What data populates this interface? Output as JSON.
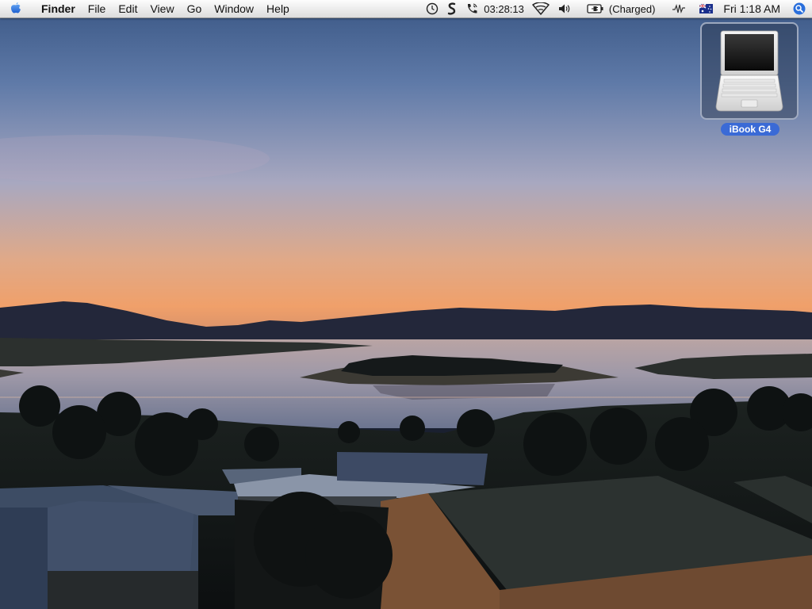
{
  "menubar": {
    "apple_icon": "apple-logo-icon",
    "app_name": "Finder",
    "menus": [
      "File",
      "Edit",
      "View",
      "Go",
      "Window",
      "Help"
    ],
    "extras": {
      "sync_icon": "sync-clock-icon",
      "script_icon": "script-s-icon",
      "phone_icon": "phone-call-icon",
      "call_timer": "03:28:13",
      "wifi_icon": "airport-wifi-icon",
      "volume_icon": "volume-speaker-icon",
      "battery_icon": "battery-plug-icon",
      "battery_status": "(Charged)",
      "network_icon": "network-activity-icon",
      "input_flag_icon": "australia-flag-icon",
      "clock": "Fri 1:18 AM",
      "spotlight_icon": "spotlight-search-icon"
    }
  },
  "desktop": {
    "icons": [
      {
        "label": "iBook G4",
        "icon": "ibook-laptop-icon"
      }
    ]
  },
  "colors": {
    "menubar_bg": "#ececec",
    "spotlight_blue": "#2a6fdc",
    "selection_label": "#3a6ad6",
    "sky_top": "#3d5a8a",
    "sky_horizon": "#e6a070"
  }
}
